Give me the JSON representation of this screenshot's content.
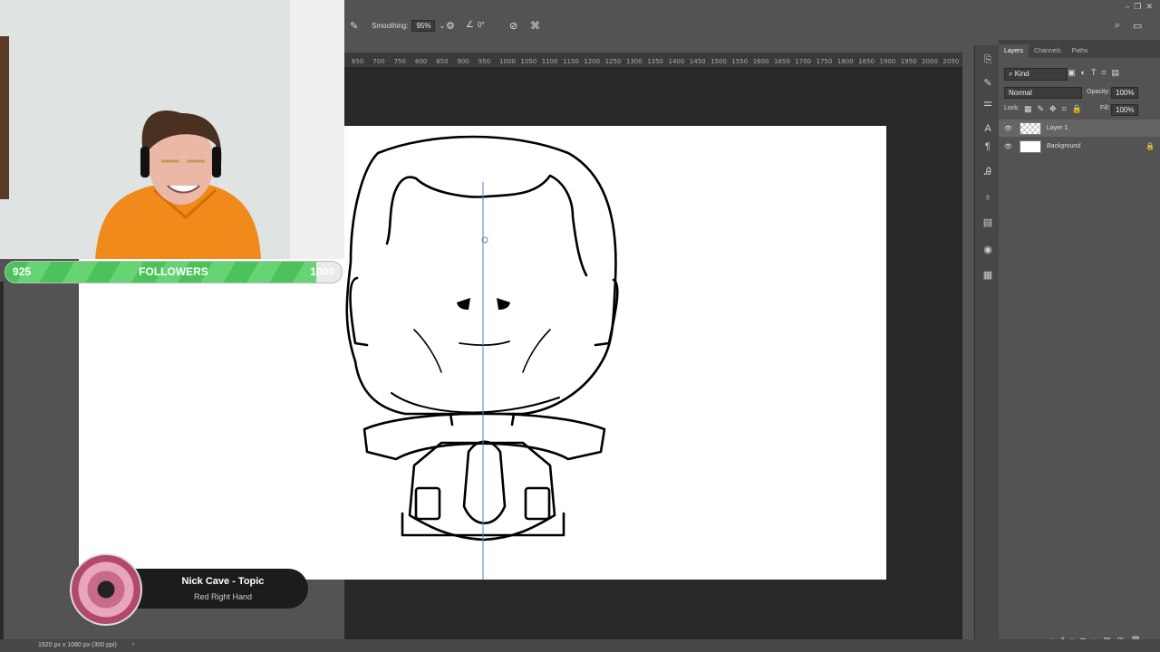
{
  "options_bar": {
    "smoothing_label": "Smoothing:",
    "smoothing_value": "95%",
    "angle_value": "0°"
  },
  "ruler": {
    "ticks": [
      "650",
      "700",
      "750",
      "800",
      "850",
      "900",
      "950",
      "1000",
      "1050",
      "1100",
      "1150",
      "1200",
      "1250",
      "1300",
      "1350",
      "1400",
      "1450",
      "1500",
      "1550",
      "1600",
      "1650",
      "1700",
      "1750",
      "1800",
      "1850",
      "1900",
      "1950",
      "2000",
      "2050"
    ]
  },
  "layers_panel": {
    "tabs": [
      "Layers",
      "Channels",
      "Paths"
    ],
    "kind_label": "Kind",
    "blend_mode": "Normal",
    "opacity_label": "Opacity:",
    "opacity_value": "100%",
    "lock_label": "Lock:",
    "fill_label": "Fill:",
    "fill_value": "100%",
    "layers": [
      {
        "name": "Layer 1",
        "selected": true
      },
      {
        "name": "Background",
        "selected": false,
        "locked": true
      }
    ]
  },
  "status_bar": {
    "doc_info": "1920 px x 1080 px (300 ppi)"
  },
  "follower_goal": {
    "current": "925",
    "label": "FOLLOWERS",
    "goal": "1000",
    "progress_fraction": 0.925
  },
  "now_playing": {
    "artist": "Nick Cave - Topic",
    "track": "Red Right Hand"
  },
  "colors": {
    "accent_green": "#4cc35a",
    "panel_bg": "#535353",
    "canvas": "#ffffff"
  }
}
